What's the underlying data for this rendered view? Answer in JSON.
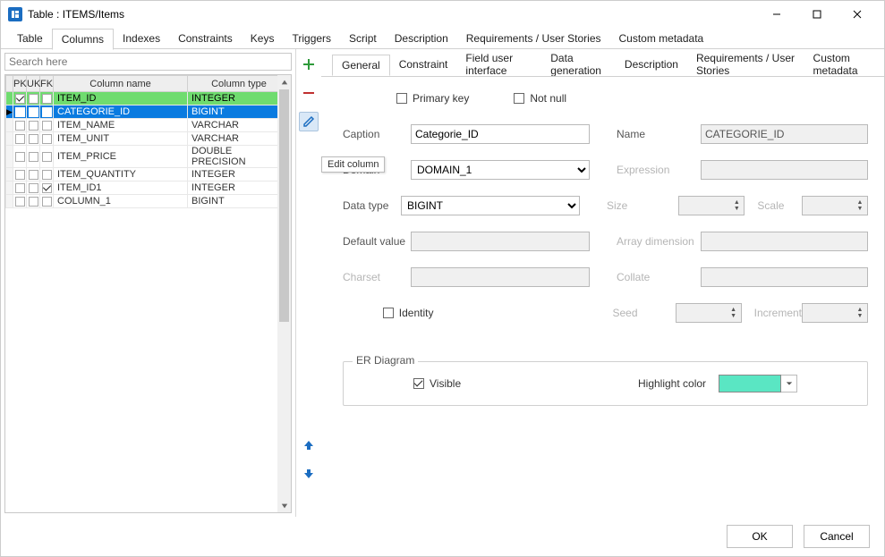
{
  "window": {
    "title": "Table : ITEMS/Items"
  },
  "main_tabs": [
    "Table",
    "Columns",
    "Indexes",
    "Constraints",
    "Keys",
    "Triggers",
    "Script",
    "Description",
    "Requirements / User Stories",
    "Custom metadata"
  ],
  "main_active": 1,
  "search_placeholder": "Search here",
  "grid": {
    "headers": {
      "pk": "PK",
      "uk": "UK",
      "fk": "FK",
      "name": "Column name",
      "type": "Column type"
    },
    "rows": [
      {
        "mark": "",
        "pk": true,
        "uk": false,
        "fk": false,
        "name": "ITEM_ID",
        "type": "INTEGER",
        "style": "green"
      },
      {
        "mark": "▶",
        "pk": false,
        "uk": false,
        "fk": true,
        "name": "CATEGORIE_ID",
        "type": "BIGINT",
        "style": "selected"
      },
      {
        "mark": "",
        "pk": false,
        "uk": false,
        "fk": false,
        "name": "ITEM_NAME",
        "type": "VARCHAR",
        "style": ""
      },
      {
        "mark": "",
        "pk": false,
        "uk": false,
        "fk": false,
        "name": "ITEM_UNIT",
        "type": "VARCHAR",
        "style": ""
      },
      {
        "mark": "",
        "pk": false,
        "uk": false,
        "fk": false,
        "name": "ITEM_PRICE",
        "type": "DOUBLE PRECISION",
        "style": ""
      },
      {
        "mark": "",
        "pk": false,
        "uk": false,
        "fk": false,
        "name": "ITEM_QUANTITY",
        "type": "INTEGER",
        "style": ""
      },
      {
        "mark": "",
        "pk": false,
        "uk": false,
        "fk": true,
        "name": "ITEM_ID1",
        "type": "INTEGER",
        "style": ""
      },
      {
        "mark": "",
        "pk": false,
        "uk": false,
        "fk": false,
        "name": "COLUMN_1",
        "type": "BIGINT",
        "style": ""
      }
    ]
  },
  "tooltip_edit": "Edit column",
  "prop_tabs": [
    "General",
    "Constraint",
    "Field user interface",
    "Data generation",
    "Description",
    "Requirements / User Stories",
    "Custom metadata"
  ],
  "prop_active": 0,
  "form": {
    "primary_key_label": "Primary key",
    "primary_key": false,
    "not_null_label": "Not null",
    "not_null": false,
    "caption_label": "Caption",
    "caption": "Categorie_ID",
    "name_label": "Name",
    "name": "CATEGORIE_ID",
    "domain_label": "Domain",
    "domain": "DOMAIN_1",
    "expression_label": "Expression",
    "expression": "",
    "datatype_label": "Data type",
    "datatype": "BIGINT",
    "size_label": "Size",
    "scale_label": "Scale",
    "default_label": "Default value",
    "default": "",
    "array_label": "Array dimension",
    "array": "",
    "charset_label": "Charset",
    "charset": "",
    "collate_label": "Collate",
    "collate": "",
    "identity_label": "Identity",
    "identity": false,
    "seed_label": "Seed",
    "increment_label": "Increment",
    "er_group": "ER Diagram",
    "visible_label": "Visible",
    "visible": true,
    "highlight_label": "Highlight color",
    "highlight_color": "#5ae6c3"
  },
  "footer": {
    "ok": "OK",
    "cancel": "Cancel"
  }
}
